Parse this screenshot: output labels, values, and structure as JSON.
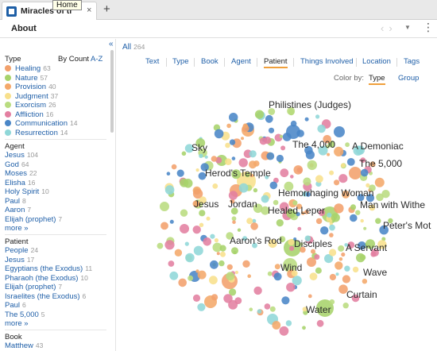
{
  "window": {
    "tab_title": "Miracles of the Bible",
    "tab_tooltip": "Home",
    "close_glyph": "×",
    "add_glyph": "+"
  },
  "toolbar": {
    "about_label": "About",
    "back_glyph": "‹",
    "forward_glyph": "›",
    "dropdown_glyph": "▼",
    "more_glyph": "⋮"
  },
  "sidebar": {
    "collapse_glyph": "«",
    "type_heading": "Type",
    "sort_label": "By Count",
    "az_label": "A-Z",
    "types": [
      {
        "label": "Healing",
        "count": "63",
        "color": "#f2a16c"
      },
      {
        "label": "Nature",
        "count": "57",
        "color": "#a7d36b"
      },
      {
        "label": "Provision",
        "count": "40",
        "color": "#f4a86a"
      },
      {
        "label": "Judgment",
        "count": "37",
        "color": "#f8e08c"
      },
      {
        "label": "Exorcism",
        "count": "26",
        "color": "#b9dc80"
      },
      {
        "label": "Affliction",
        "count": "16",
        "color": "#e37fa1"
      },
      {
        "label": "Communication",
        "count": "14",
        "color": "#4a86c7"
      },
      {
        "label": "Resurrection",
        "count": "14",
        "color": "#8fd7d8"
      }
    ],
    "agent_heading": "Agent",
    "agents": [
      {
        "label": "Jesus",
        "count": "104"
      },
      {
        "label": "God",
        "count": "64"
      },
      {
        "label": "Moses",
        "count": "22"
      },
      {
        "label": "Elisha",
        "count": "16"
      },
      {
        "label": "Holy Spirit",
        "count": "10"
      },
      {
        "label": "Paul",
        "count": "8"
      },
      {
        "label": "Aaron",
        "count": "7"
      },
      {
        "label": "Elijah (prophet)",
        "count": "7"
      }
    ],
    "agent_more": "more »",
    "patient_heading": "Patient",
    "patients": [
      {
        "label": "People",
        "count": "24"
      },
      {
        "label": "Jesus",
        "count": "17"
      },
      {
        "label": "Egyptians (the Exodus)",
        "count": "11"
      },
      {
        "label": "Pharaoh (the Exodus)",
        "count": "10"
      },
      {
        "label": "Elijah (prophet)",
        "count": "7"
      },
      {
        "label": "Israelites (the Exodus)",
        "count": "6"
      },
      {
        "label": "Paul",
        "count": "6"
      },
      {
        "label": "The 5,000",
        "count": "5"
      }
    ],
    "patient_more": "more »",
    "book_heading": "Book",
    "books": [
      {
        "label": "Matthew",
        "count": "43"
      }
    ]
  },
  "main": {
    "all_label": "All",
    "all_count": "264",
    "tabs": [
      "Text",
      "Type",
      "Book",
      "Agent",
      "Patient",
      "Things Involved",
      "Location",
      "Tags"
    ],
    "active_tab": "Patient",
    "color_by_label": "Color by:",
    "color_by_options": [
      "Type",
      "Group"
    ],
    "color_by_active": "Type",
    "bubble_labels": [
      "Philistines (Judges)",
      "Sky",
      "The 4,000",
      "A Demoniac",
      "Herod's Temple",
      "The 5,000",
      "Hemorrhaging Woman",
      "Jesus",
      "Jordan",
      "Healed Leper",
      "Man with Withe",
      "Peter's Mot",
      "Aaron's Rod",
      "Disciples",
      "A Servant",
      "Wind",
      "Wave",
      "Curtain",
      "Water"
    ]
  }
}
